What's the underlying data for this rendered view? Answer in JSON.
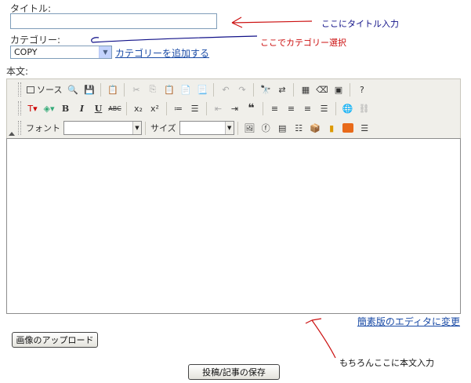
{
  "form": {
    "title_label": "タイトル:",
    "title_value": "",
    "category_label": "カテゴリー:",
    "category_selected": "COPY",
    "add_category_link": "カテゴリーを追加する",
    "body_label": "本文:",
    "simple_editor_link": "簡素版のエディタに変更",
    "upload_button": "画像のアップロード",
    "save_button": "投稿/記事の保存"
  },
  "toolbar": {
    "source_label": "ソース",
    "font_label": "フォント",
    "size_label": "サイズ",
    "bold": "B",
    "italic": "I",
    "underline": "U",
    "strike": "ABC",
    "subscript": "x₂",
    "superscript": "x²"
  },
  "annotations": {
    "title_note": "ここにタイトル入力",
    "category_note": "ここでカテゴリー選択",
    "body_note": "もちろんここに本文入力"
  },
  "colors": {
    "annotation_red": "#cc1111",
    "annotation_blue": "#111188",
    "link": "#1a4ba6"
  }
}
